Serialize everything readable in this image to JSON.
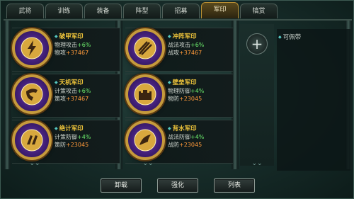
{
  "tabs": [
    {
      "label": "武将"
    },
    {
      "label": "训练"
    },
    {
      "label": "装备"
    },
    {
      "label": "阵型"
    },
    {
      "label": "招募"
    },
    {
      "label": "军印"
    },
    {
      "label": "犒赏"
    }
  ],
  "active_tab": "军印",
  "seals": [
    {
      "name": "破甲军印",
      "effect_label": "物理攻击",
      "effect_value": "+6%",
      "stat_label": "物攻",
      "stat_value": "+37467",
      "icon": "lightning-icon"
    },
    {
      "name": "冲阵军印",
      "effect_label": "战法攻击",
      "effect_value": "+6%",
      "stat_label": "战攻",
      "stat_value": "+37467",
      "icon": "arrows-icon"
    },
    {
      "name": "天机军印",
      "effect_label": "计策攻击",
      "effect_value": "+6%",
      "stat_label": "策攻",
      "stat_value": "+37467",
      "icon": "horn-icon"
    },
    {
      "name": "壁垒军印",
      "effect_label": "物理防御",
      "effect_value": "+4%",
      "stat_label": "物防",
      "stat_value": "+23045",
      "icon": "fortress-icon"
    },
    {
      "name": "绝计军印",
      "effect_label": "计策防御",
      "effect_value": "+4%",
      "stat_label": "策防",
      "stat_value": "+23045",
      "icon": "scroll-icon"
    },
    {
      "name": "背水军印",
      "effect_label": "战法防御",
      "effect_value": "+4%",
      "stat_label": "战防",
      "stat_value": "+23045",
      "icon": "blade-icon"
    }
  ],
  "carry": {
    "label": "可佩带"
  },
  "buttons": {
    "unequip": "卸载",
    "strengthen": "强化",
    "list": "列表"
  }
}
